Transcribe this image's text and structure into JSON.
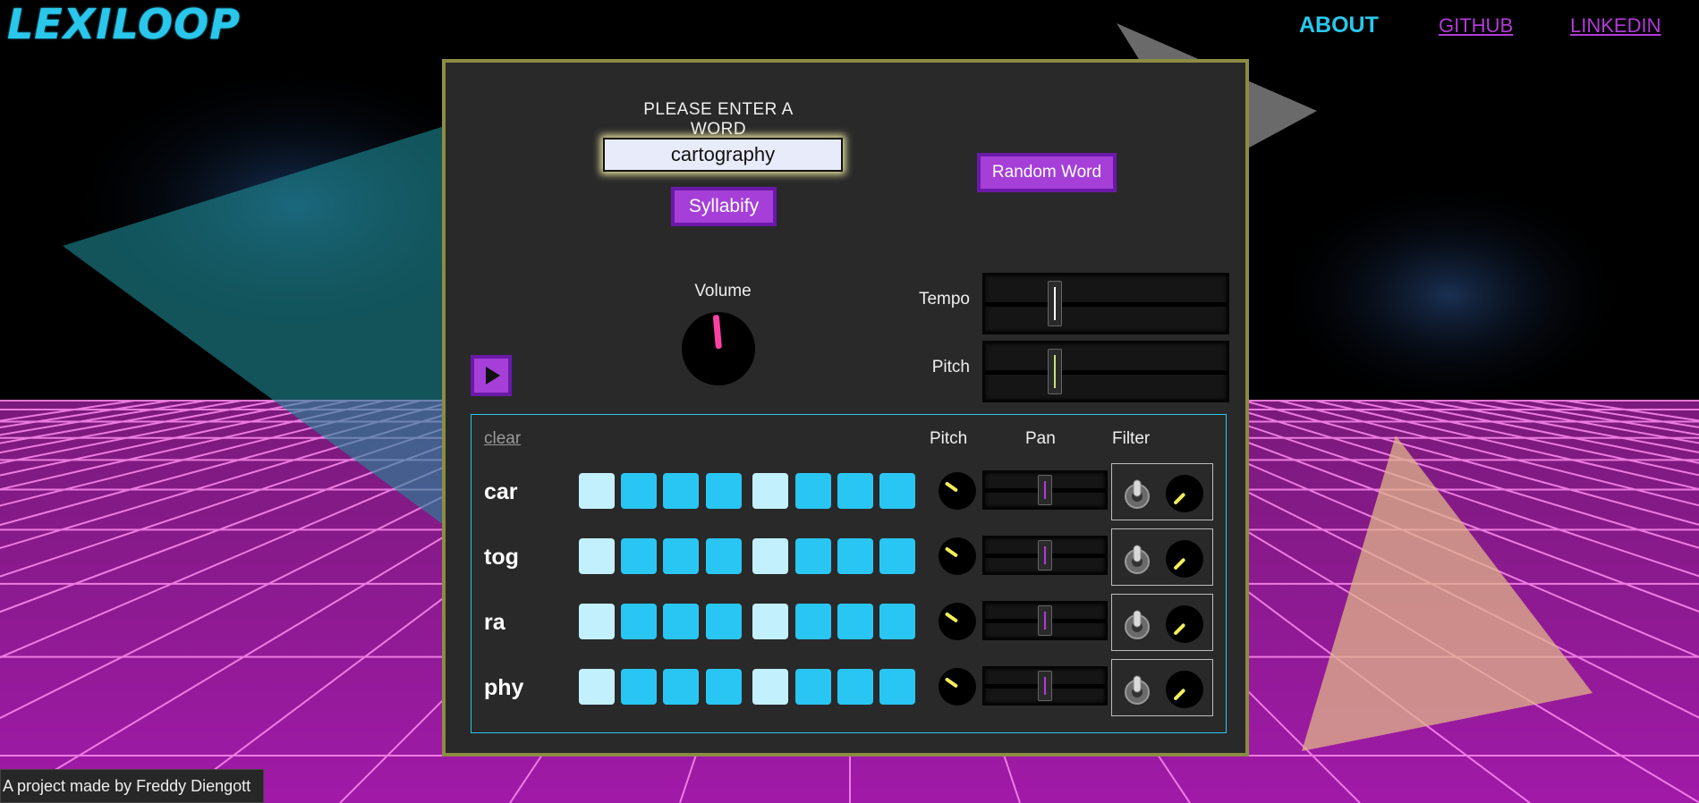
{
  "app": {
    "logo": "LEXILOOP"
  },
  "nav": {
    "about": "ABOUT",
    "github": "GITHUB",
    "linkedin": "LINKEDIN"
  },
  "form": {
    "prompt": "PLEASE ENTER A WORD",
    "word_value": "cartography",
    "syllabify_label": "Syllabify",
    "random_label": "Random Word"
  },
  "controls": {
    "volume_label": "Volume",
    "tempo_label": "Tempo",
    "pitch_label": "Pitch",
    "tempo_level": 0.29,
    "pitch_level": 0.29,
    "volume_angle_deg": -5
  },
  "sequencer": {
    "clear_label": "clear",
    "col_pitch": "Pitch",
    "col_pan": "Pan",
    "col_filter": "Filter",
    "pattern": [
      1,
      0,
      0,
      0,
      1,
      0,
      0,
      0
    ],
    "rows": [
      {
        "label": "car",
        "pan": 0.5,
        "pitch_angle_deg": -55,
        "filter_angle_deg": -135
      },
      {
        "label": "tog",
        "pan": 0.5,
        "pitch_angle_deg": -55,
        "filter_angle_deg": -135
      },
      {
        "label": "ra",
        "pan": 0.5,
        "pitch_angle_deg": -55,
        "filter_angle_deg": -135
      },
      {
        "label": "phy",
        "pan": 0.5,
        "pitch_angle_deg": -55,
        "filter_angle_deg": -135
      }
    ]
  },
  "footer": {
    "text": "A project made by Freddy Diengott"
  },
  "colors": {
    "accent": "#2ac7ec",
    "purple": "#a53fd8",
    "step_on": "#29c6f4",
    "step_accent": "#c2f0fd",
    "volume_indicator": "#ff3fa4",
    "knob_indicator": "#f2ee5a"
  },
  "icons": {
    "play": "play-icon",
    "toggle": "toggle-switch-icon"
  }
}
